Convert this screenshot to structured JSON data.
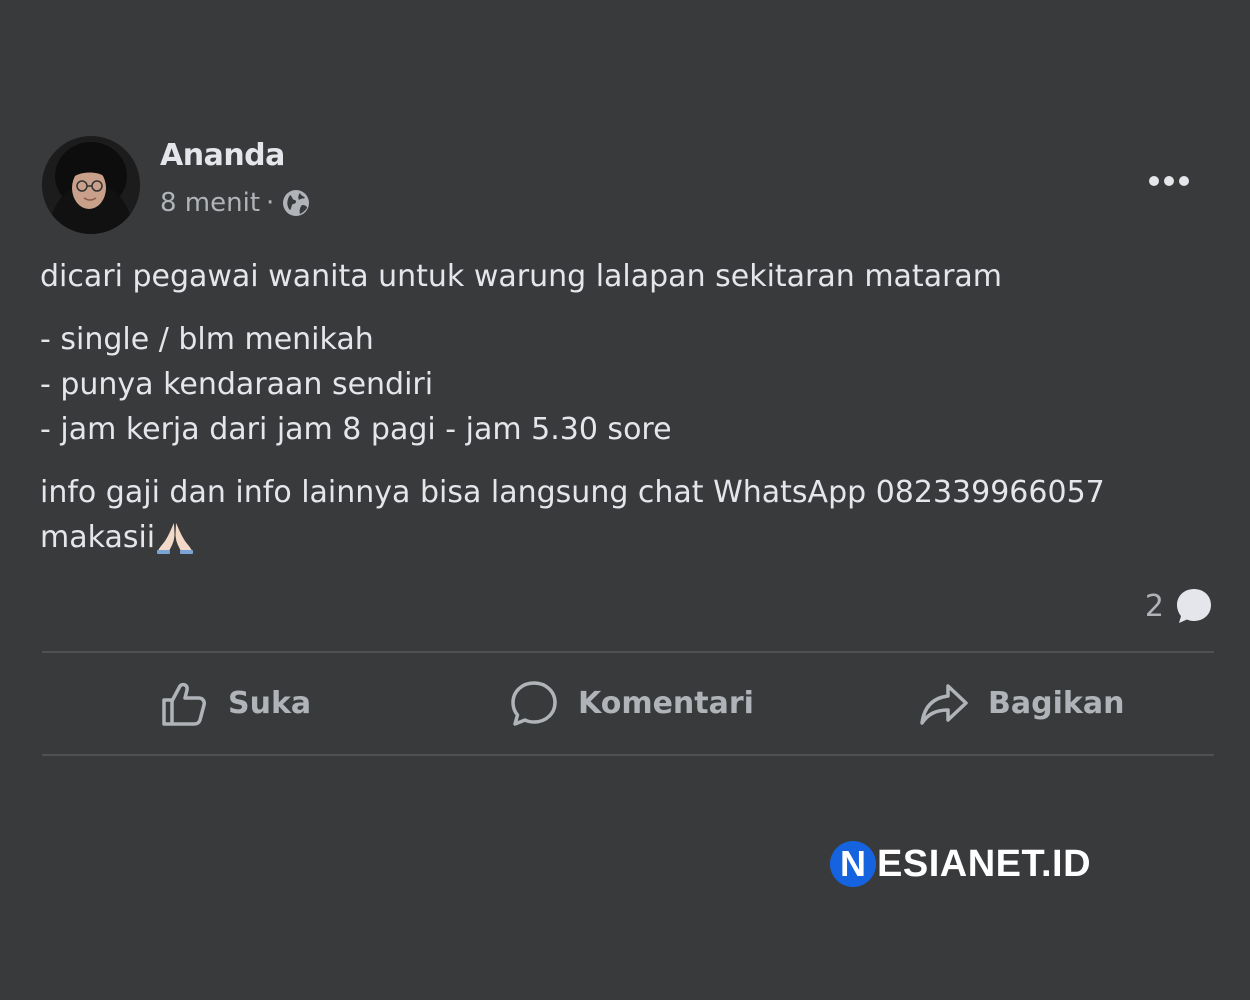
{
  "post": {
    "author": "Ananda",
    "time": "8 menit",
    "separator": "·",
    "visibility_icon": "globe-icon",
    "more_icon": "more-options-icon",
    "paragraphs": [
      [
        "dicari pegawai wanita untuk warung lalapan sekitaran mataram"
      ],
      [
        "- single / blm menikah",
        "- punya kendaraan sendiri",
        "- jam kerja dari jam 8 pagi - jam 5.30 sore"
      ],
      [
        "info gaji dan info lainnya bisa langsung chat WhatsApp 082339966057",
        "makasii"
      ]
    ],
    "emoji": "folded-hands-emoji",
    "comment_count": "2",
    "comment_count_icon": "comment-bubble-icon"
  },
  "actions": {
    "like_label": "Suka",
    "like_icon": "thumbs-up-icon",
    "comment_label": "Komentari",
    "comment_icon": "comment-icon",
    "share_label": "Bagikan",
    "share_icon": "share-arrow-icon"
  },
  "watermark": {
    "badge_letter": "N",
    "text": "ESIANET.ID"
  },
  "colors": {
    "background": "#383a3c",
    "primary_text": "#e4e6eb",
    "secondary_text": "#b0b3b8",
    "divider": "#4e5154",
    "watermark_badge": "#1663e0"
  }
}
